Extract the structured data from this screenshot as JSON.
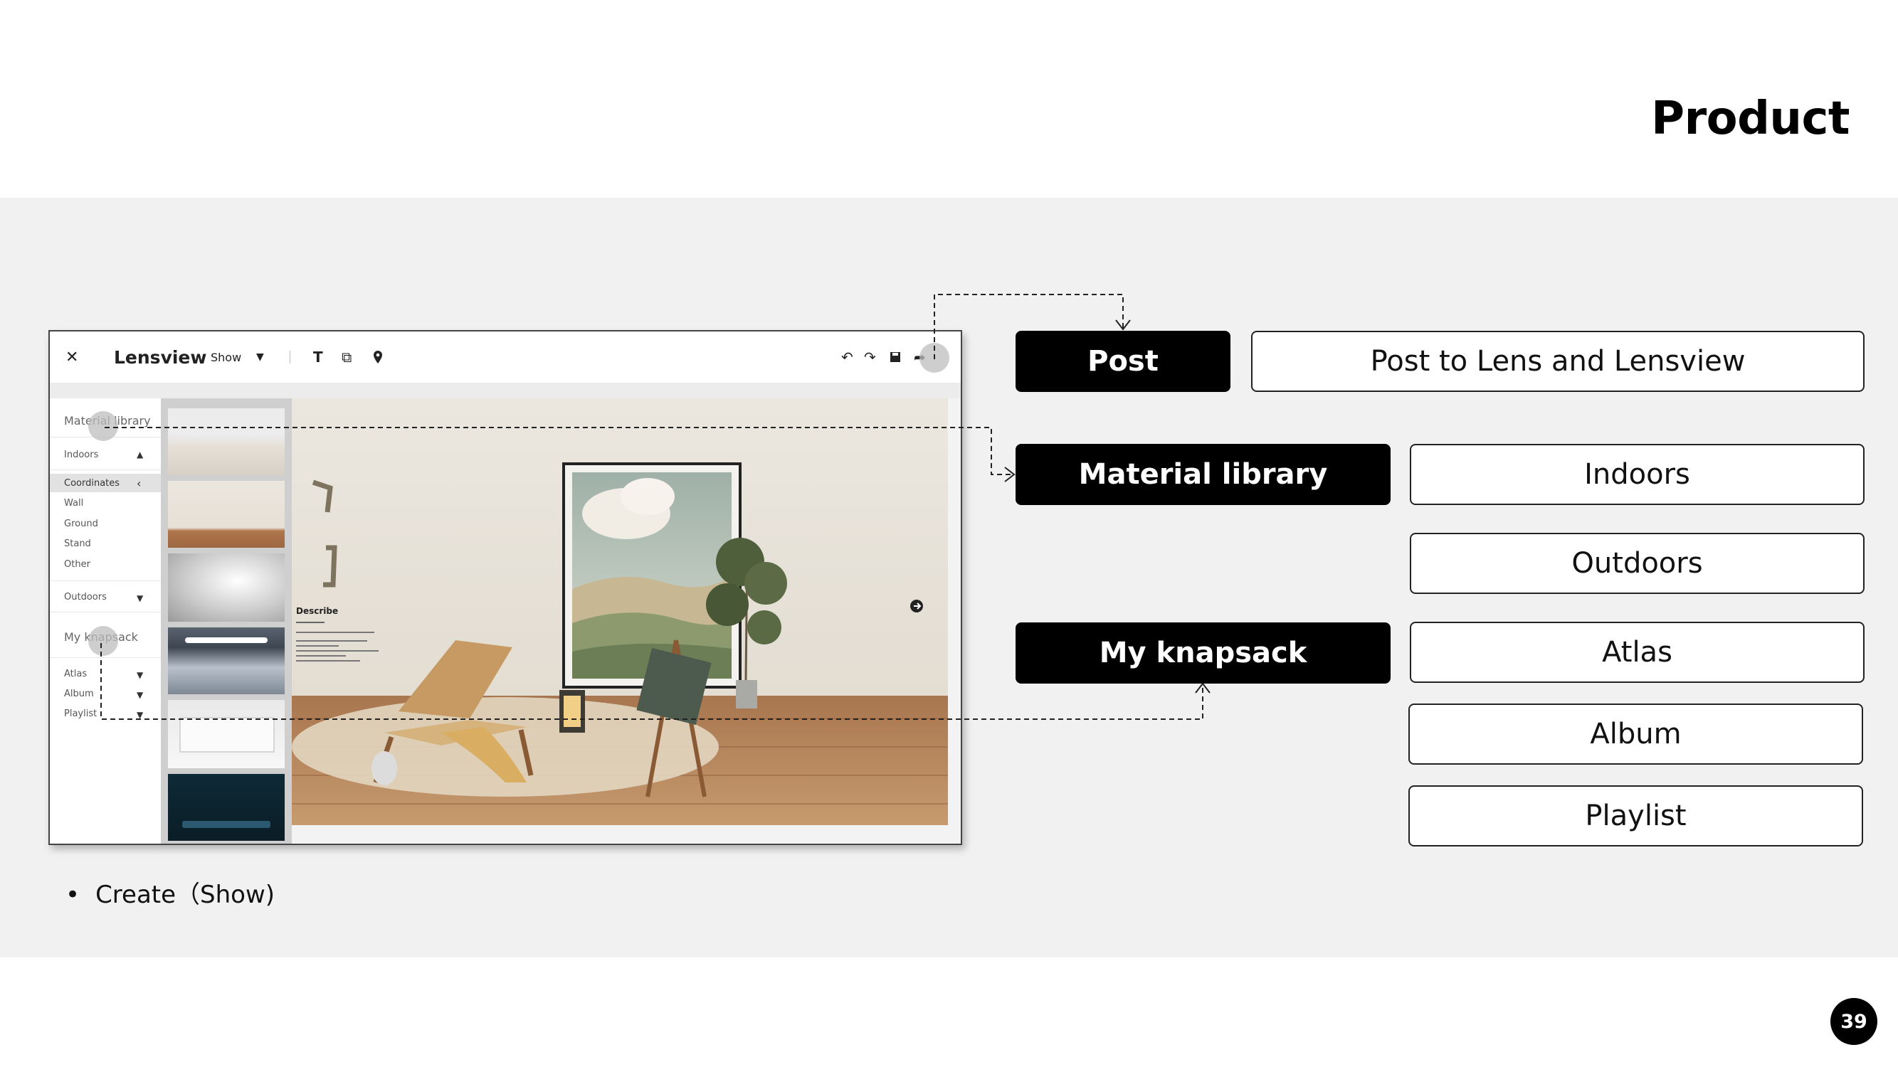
{
  "slide": {
    "title": "Product",
    "page_number": "39"
  },
  "app": {
    "close_icon": "close-icon",
    "name": "Lensview",
    "mode": "Show",
    "toolbar_icons": [
      "text-icon",
      "layers-icon",
      "location-pin-icon",
      "undo-icon",
      "redo-icon",
      "save-icon",
      "share-icon"
    ],
    "sidebar": {
      "material_library": "Material library",
      "indoors": "Indoors",
      "coordinates": "Coordinates",
      "sub_items": [
        "Wall",
        "Ground",
        "Stand",
        "Other"
      ],
      "outdoors": "Outdoors",
      "my_knapsack": "My knapsack",
      "knapsack_items": [
        "Atlas",
        "Album",
        "Playlist"
      ]
    },
    "canvas": {
      "describe_label": "Describe"
    }
  },
  "flow": {
    "post": "Post",
    "post_desc": "Post to Lens and Lensview",
    "material_library": "Material library",
    "my_knapsack": "My knapsack",
    "options": [
      "Indoors",
      "Outdoors",
      "Atlas",
      "Album",
      "Playlist"
    ]
  },
  "bullet": "Create（Show)",
  "colors": {
    "band": "#f1f1f1",
    "dark_box": "#000000",
    "floor": "#b8875a"
  }
}
